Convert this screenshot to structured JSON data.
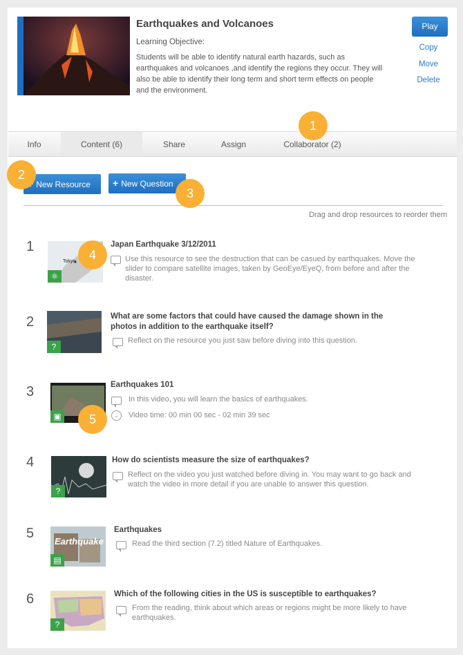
{
  "lesson": {
    "title": "Earthquakes and Volcanoes",
    "objective_label": "Learning Objective:",
    "objective_text": "Students will be able to identify natural earth hazards, such as earthquakes and volcanoes ,and identify the regions they occur. They will also be able to identify their long term and short term effects on people and the environment."
  },
  "actions": {
    "play": "Play",
    "copy": "Copy",
    "move": "Move",
    "delete": "Delete"
  },
  "tabs": [
    "Info",
    "Content (6)",
    "Share",
    "Assign",
    "Collaborator (2)"
  ],
  "toolbar": {
    "new_resource": "New Resource",
    "new_question": "New Question",
    "drag_hint": "Drag and drop resources to reorder them"
  },
  "badges": [
    "1",
    "2",
    "3",
    "4",
    "5"
  ],
  "items": [
    {
      "num": "1",
      "title": "Japan Earthquake 3/12/2011",
      "desc": "Use this resource to see the destruction that can be casued by earthquakes. Move the slider to compare satellite images, taken by GeoEye/EyeQ, from before and after the disaster.",
      "type_icon": "atom-icon",
      "thumb_text": "Tokyo"
    },
    {
      "num": "2",
      "title": "What are some factors that could have caused the damage shown in the photos in addition to the earthquake itself?",
      "desc": "Reflect on the resource you just saw before diving into this question.",
      "type_icon": "question-icon"
    },
    {
      "num": "3",
      "title": "Earthquakes 101",
      "desc": "In this video, you will learn the basics of earthquakes.",
      "extra": "Video time: 00 min 00 sec - 02 min 39 sec",
      "type_icon": "video-icon"
    },
    {
      "num": "4",
      "title": "How do scientists measure the size of earthquakes?",
      "desc": "Reflect on the video you just watched before diving in. You may want to go back and watch the video in more detail if you are unable to answer this question.",
      "type_icon": "question-icon"
    },
    {
      "num": "5",
      "title": "Earthquakes",
      "desc": "Read the third section (7.2) titled Nature of Earthquakes.",
      "type_icon": "document-icon",
      "thumb_text": "Earthquake"
    },
    {
      "num": "6",
      "title": "Which of the following cities in the US is susceptible to earthquakes?",
      "desc": "From the reading, think about which areas or regions might be more likely to have earthquakes.",
      "type_icon": "question-icon"
    }
  ],
  "colors": {
    "accent": "#1f6fc0",
    "badge": "#f9b035",
    "type_icon": "#3aa34a"
  }
}
